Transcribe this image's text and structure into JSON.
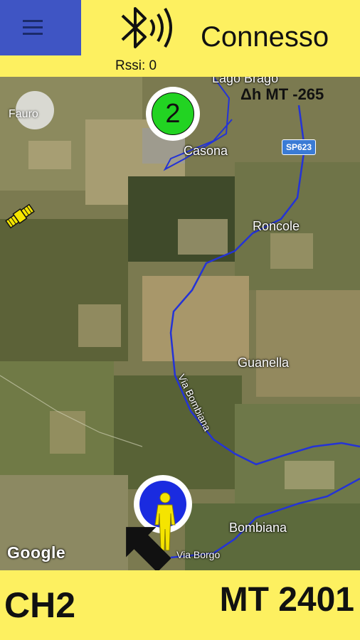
{
  "header": {
    "menu_icon": "hamburger-menu-icon",
    "bluetooth_icon": "bluetooth-signal-icon",
    "rssi_label": "Rssi: 0",
    "connection_status": "Connesso",
    "menu_color": "#3f55c4",
    "bar_color": "#fdf060"
  },
  "map": {
    "delta_label": "Δh MT -265",
    "road_shield": "SP623",
    "attribution": "Google",
    "compass_label": "Fauro",
    "places": [
      "Lago Brago",
      "Casona",
      "Roncole",
      "Guanella",
      "Via Bombiana",
      "Bombiana",
      "Via Borgo"
    ],
    "channel_marker": "2",
    "channel_marker_color": "#22d322",
    "user_marker_color": "#1a2be0",
    "route_color": "#2433d6",
    "satellite_icon": "satellite-icon",
    "person_icon": "person-icon",
    "arrow_icon": "direction-arrow-icon"
  },
  "footer": {
    "channel": "CH2",
    "mt_value": "MT 2401"
  }
}
